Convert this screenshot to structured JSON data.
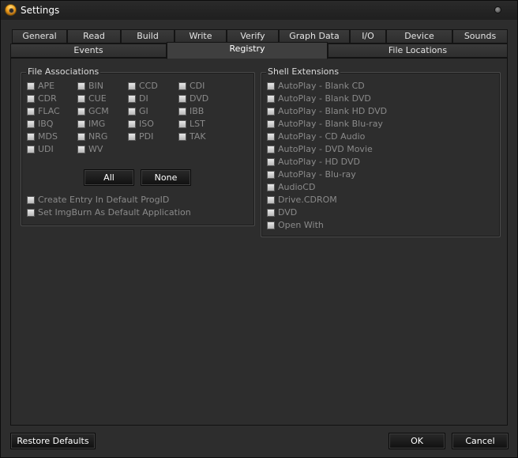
{
  "window": {
    "title": "Settings"
  },
  "tabs_row1": [
    {
      "label": "General"
    },
    {
      "label": "Read"
    },
    {
      "label": "Build"
    },
    {
      "label": "Write"
    },
    {
      "label": "Verify"
    },
    {
      "label": "Graph Data"
    },
    {
      "label": "I/O"
    },
    {
      "label": "Device"
    },
    {
      "label": "Sounds"
    }
  ],
  "tabs_row2": [
    {
      "label": "Events"
    },
    {
      "label": "Registry",
      "active": true
    },
    {
      "label": "File Locations"
    }
  ],
  "file_associations": {
    "label": "File Associations",
    "items": [
      "APE",
      "BIN",
      "CCD",
      "CDI",
      "CDR",
      "CUE",
      "DI",
      "DVD",
      "FLAC",
      "GCM",
      "GI",
      "IBB",
      "IBQ",
      "IMG",
      "ISO",
      "LST",
      "MDS",
      "NRG",
      "PDI",
      "TAK",
      "UDI",
      "WV"
    ],
    "all_button": "All",
    "none_button": "None",
    "options": [
      "Create Entry In Default ProgID",
      "Set ImgBurn As Default Application"
    ]
  },
  "shell_extensions": {
    "label": "Shell Extensions",
    "items": [
      "AutoPlay - Blank CD",
      "AutoPlay - Blank DVD",
      "AutoPlay - Blank HD DVD",
      "AutoPlay - Blank Blu-ray",
      "AutoPlay - CD Audio",
      "AutoPlay - DVD Movie",
      "AutoPlay - HD DVD",
      "AutoPlay - Blu-ray",
      "AudioCD",
      "Drive.CDROM",
      "DVD",
      "Open With"
    ]
  },
  "footer": {
    "restore_defaults": "Restore Defaults",
    "ok": "OK",
    "cancel": "Cancel"
  }
}
